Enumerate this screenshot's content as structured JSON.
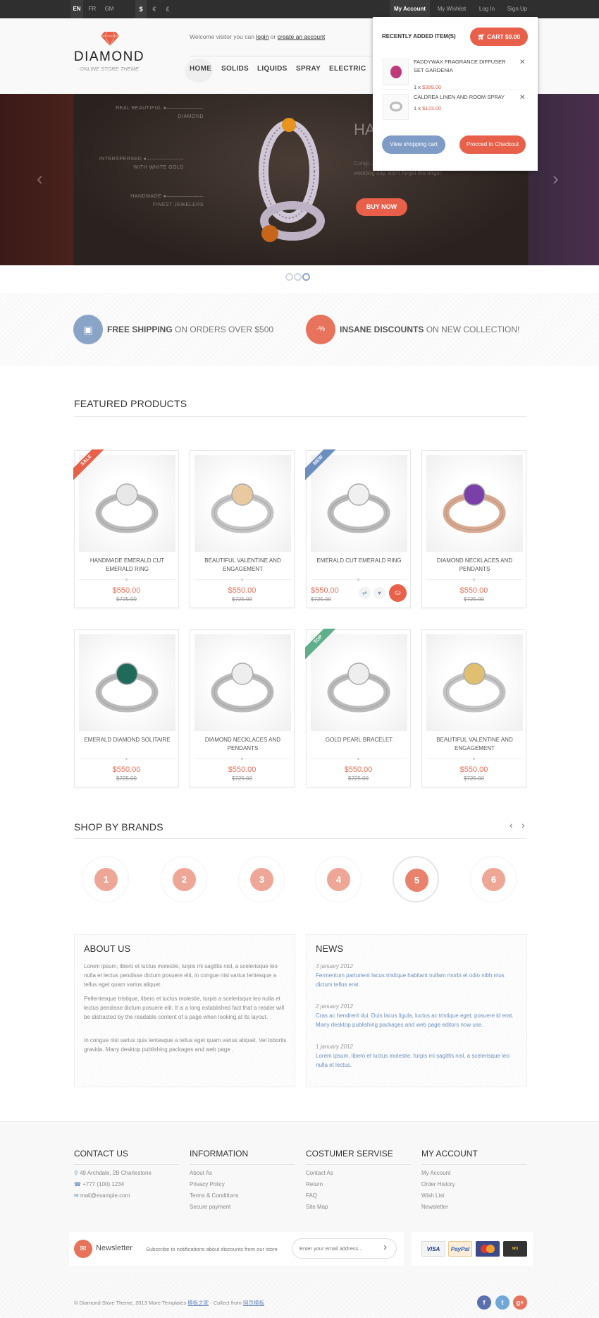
{
  "topbar": {
    "languages": [
      "EN",
      "FR",
      "GM"
    ],
    "currencies": [
      "$",
      "€",
      "£"
    ],
    "links": [
      "My Account",
      "My Wishlist",
      "Log In",
      "Sign Up"
    ]
  },
  "header": {
    "logo": "DIAMOND",
    "tagline": "ONLINE STORE THEME",
    "welcome": "Welcome visitor you can",
    "login": "login",
    "or": "or",
    "create": "create an account",
    "nav": [
      "HOME",
      "SOLIDS",
      "LIQUIDS",
      "SPRAY",
      "ELECTRIC"
    ]
  },
  "cart": {
    "title": "RECENTLY ADDED ITEM(S)",
    "button": "CART $0.00",
    "items": [
      {
        "name": "FADDYWAX FRAGRANCE DIFFUSER SET GARDENIA",
        "qty": "1 x",
        "price": "$399.00"
      },
      {
        "name": "CALDREA LINEN AND ROOM SPRAY",
        "qty": "1 x",
        "price": "$123.00"
      }
    ],
    "view": "View shopping cart",
    "checkout": "Procced to Checkout"
  },
  "slider": {
    "labels": [
      {
        "l1": "REAL BEAUTIFUL",
        "l2": "DIAMOND"
      },
      {
        "l1": "INTERSPERSED",
        "l2": "WITH WHITE GOLD"
      },
      {
        "l1": "HANDMADE",
        "l2": "FINEST JEWELERS"
      }
    ],
    "title": "HA",
    "text": "Congr... begin to plan the many details of your wedding day, don't forget the rings!",
    "button": "BUY NOW",
    "active_slide": 3,
    "slides": 3
  },
  "features": [
    {
      "bold": "FREE SHIPPING",
      "rest": "ON ORDERS OVER $500",
      "color": "#8aa4c8",
      "icon": "truck-icon"
    },
    {
      "bold": "INSANE DISCOUNTS",
      "rest": "ON NEW COLLECTION!",
      "color": "#e8735c",
      "icon": "discount-tag-icon"
    }
  ],
  "featured": {
    "title": "FEATURED PRODUCTS",
    "products": [
      {
        "name": "HANDMADE EMERALD CUT EMERALD RING",
        "price": "$550.00",
        "old": "$725.00",
        "badge": "SALE",
        "badge_color": "#e8604a",
        "stone": "#e8e8e8",
        "metal": "#bbb"
      },
      {
        "name": "BEAUTIFUL VALENTINE AND ENGAGEMENT",
        "price": "$550.00",
        "old": "$725.00",
        "badge": "",
        "stone": "#e8c9a0",
        "metal": "#c4c4c4"
      },
      {
        "name": "EMERALD CUT EMERALD RING",
        "price": "$550.00",
        "old": "$725.00",
        "badge": "NEW",
        "badge_color": "#6d8fbf",
        "stone": "#f0f0f0",
        "metal": "#bbb",
        "hover": true
      },
      {
        "name": "DIAMOND NECKLACES AND PENDANTS",
        "price": "$550.00",
        "old": "$725.00",
        "badge": "",
        "stone": "#7b3fa8",
        "metal": "#d9a88e"
      },
      {
        "name": "EMERALD DIAMOND SOLITAIRE",
        "price": "$550.00",
        "old": "$725.00",
        "badge": "",
        "stone": "#1e6b5a",
        "metal": "#bbb"
      },
      {
        "name": "DIAMOND NECKLACES AND PENDANTS",
        "price": "$550.00",
        "old": "$725.00",
        "badge": "",
        "stone": "#eee",
        "metal": "#bbb"
      },
      {
        "name": "GOLD PEARL BRACELET",
        "price": "$550.00",
        "old": "$725.00",
        "badge": "TOP",
        "badge_color": "#5fb08a",
        "stone": "#eee",
        "metal": "#bbb"
      },
      {
        "name": "BEAUTIFUL VALENTINE AND ENGAGEMENT",
        "price": "$550.00",
        "old": "$725.00",
        "badge": "",
        "stone": "#e0c070",
        "metal": "#c4c4c4"
      }
    ]
  },
  "brands": {
    "title": "SHOP BY BRANDS",
    "items": [
      "1",
      "2",
      "3",
      "4",
      "5",
      "6"
    ],
    "active": "5"
  },
  "about": {
    "title": "ABOUT US",
    "paragraphs": [
      "Lorem ipsum, libero et luctus molestie, turpis mi sagittis nisl, a scelerisque leo nulla et lectus pendisse dictum posuere elit, in congue nisl varius lentesque a tellus eget quam varius aliquet.",
      "Pellentesque tristique, libero et luctus molestie, turpis a scelerisque leo nulla et lectus pendisse dictum posuere elit. It is a long established fact that a reader will be distracted by the readable content of a page when looking at its layout.",
      "In congue nisl varius quis lentesque a tellus eget quam varius aliquet. Vel lobortis gravida. Many desktop publishing packages and web page ."
    ]
  },
  "news": {
    "title": "NEWS",
    "items": [
      {
        "date": "3 january 2012",
        "text": "Fermentum parturient lacus tristique habitant nullam morbi et odio nibh mus dictum tellus erat."
      },
      {
        "date": "2 january 2012",
        "text": "Cras ac hendrerit dui. Duis lacus ligula, luctus ac tristique eget, posuere id erat. Many desktop publishing packages and web page editors now use."
      },
      {
        "date": "1 january 2012",
        "text": "Lorem ipsum, libero et luctus molestie, turpis mi sagittis nisl, a scelerisque leo nulla et lectus."
      }
    ]
  },
  "footer": {
    "contact": {
      "title": "CONTACT US",
      "address": "49 Archdale, 2B Charlestone",
      "phone": "+777 (100) 1234",
      "email": "mail@example.com"
    },
    "information": {
      "title": "INFORMATION",
      "links": [
        "About As",
        "Privacy Policy",
        "Terms & Conditions",
        "Secure payment"
      ]
    },
    "service": {
      "title": "COSTUMER SERVISE",
      "links": [
        "Contact As",
        "Return",
        "FAQ",
        "Site Map"
      ]
    },
    "account": {
      "title": "MY ACCOUNT",
      "links": [
        "My Account",
        "Order History",
        "Wish List",
        "Newsletter"
      ]
    },
    "newsletter": {
      "label": "Newsletter",
      "text": "Subscribe to notifications about discounts from our store",
      "placeholder": "Enter your email address..."
    },
    "payments": [
      "VISA",
      "PayPal",
      "MasterCard",
      "Western Union"
    ],
    "copyright": "© Diamond Store Theme, 2013 More Templates",
    "link1": "模板之家",
    "collect": "- Collect from",
    "link2": "网页模板",
    "social": [
      "f",
      "t",
      "g+"
    ]
  },
  "colors": {
    "accent": "#e8604a",
    "blue": "#6d8fbf",
    "dark": "#2f2f2f"
  }
}
